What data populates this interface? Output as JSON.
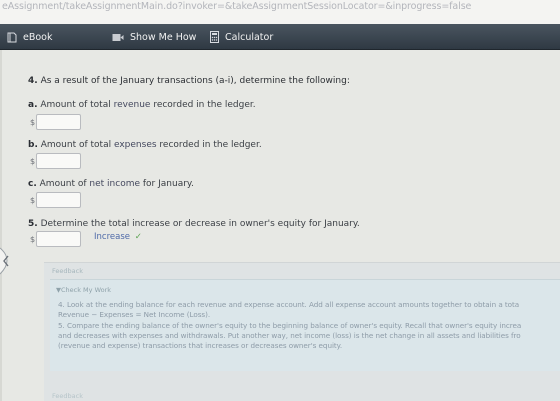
{
  "browser": {
    "url_fragment": "eAssignment/takeAssignmentMain.do?invoker=&takeAssignmentSessionLocator=&inprogress=false"
  },
  "toolbar": {
    "ebook_label": "eBook",
    "show_me_how_label": "Show Me How",
    "calculator_label": "Calculator"
  },
  "question": {
    "number": "4.",
    "prompt": "As a result of the January transactions (a-i), determine the following:",
    "parts": [
      {
        "letter": "a.",
        "text_before": "Amount of total ",
        "highlight": "revenue",
        "text_after": " recorded in the ledger."
      },
      {
        "letter": "b.",
        "text_before": "Amount of total ",
        "highlight": "expenses",
        "text_after": " recorded in the ledger."
      },
      {
        "letter": "c.",
        "text_before": "Amount of ",
        "highlight": "net income",
        "text_after": " for January."
      },
      {
        "letter": "5.",
        "text_before": "Determine the total increase or decrease in owner's equity for January.",
        "highlight": "",
        "text_after": ""
      }
    ],
    "currency_symbol": "$",
    "equity_change_selected": "Increase"
  },
  "feedback": {
    "title": "Feedback",
    "subtitle": "▼Check My Work",
    "lines": [
      "4. Look at the ending balance for each revenue and expense account. Add all expense account amounts together to obtain a tota",
      "Revenue − Expenses = Net Income (Loss).",
      "5. Compare the ending balance of the owner's equity to the beginning balance of owner's equity. Recall that owner's equity increa",
      "and decreases with expenses and withdrawals. Put another way, net income (loss) is the net change in all assets and liabilities fro",
      "(revenue and expense) transactions that increases or decreases owner's equity."
    ],
    "footer": "Feedback"
  },
  "colors": {
    "toolbar_bg": "#3a444e",
    "link_blue": "#4f6aa8",
    "check_green": "#5aa14f"
  }
}
